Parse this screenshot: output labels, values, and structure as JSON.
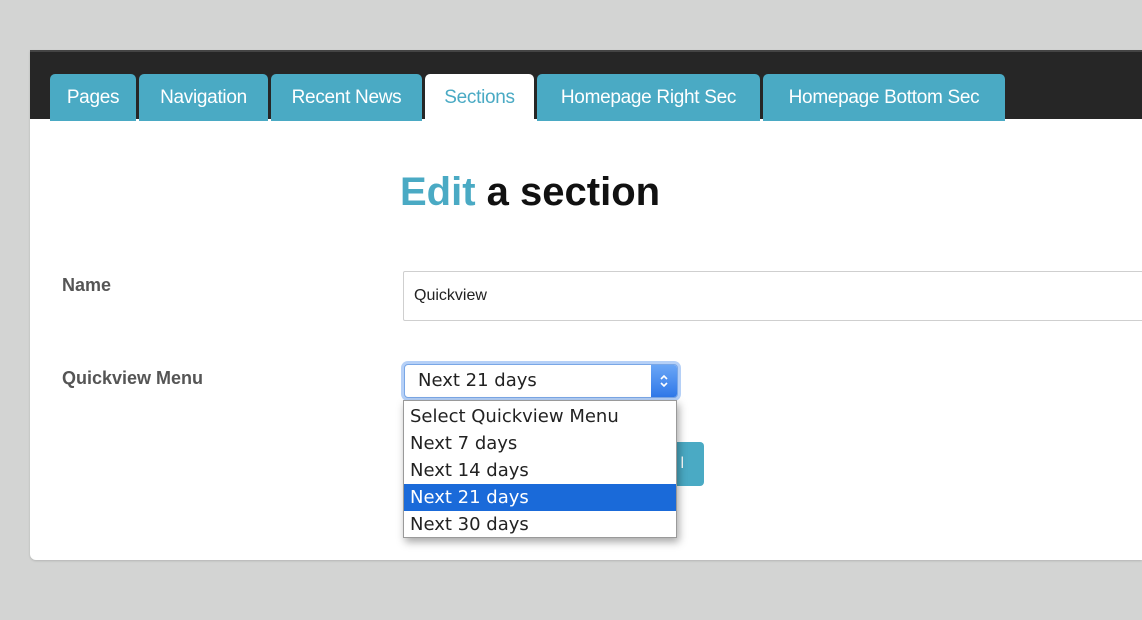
{
  "tabs": [
    {
      "label": "Pages",
      "active": false
    },
    {
      "label": "Navigation",
      "active": false
    },
    {
      "label": "Recent News",
      "active": false
    },
    {
      "label": "Sections",
      "active": true
    },
    {
      "label": "Homepage Right Sec",
      "active": false
    },
    {
      "label": "Homepage Bottom Sec",
      "active": false
    }
  ],
  "heading": {
    "accent": "Edit",
    "rest": " a section"
  },
  "form": {
    "name_label": "Name",
    "name_value": "Quickview",
    "menu_label": "Quickview Menu",
    "menu_selected": "Next 21 days",
    "menu_options": [
      {
        "label": "Select Quickview Menu",
        "selected": false
      },
      {
        "label": "Next 7 days",
        "selected": false
      },
      {
        "label": "Next 14 days",
        "selected": false
      },
      {
        "label": "Next 21 days",
        "selected": true
      },
      {
        "label": "Next 30 days",
        "selected": false
      }
    ],
    "submit_partial": "l"
  },
  "colors": {
    "accent": "#4aaac4",
    "tabbar": "#262626",
    "selection": "#1a6ad9",
    "page_bg": "#d3d4d3"
  },
  "icons": {
    "select_arrow": "chevron-up-down-icon"
  }
}
